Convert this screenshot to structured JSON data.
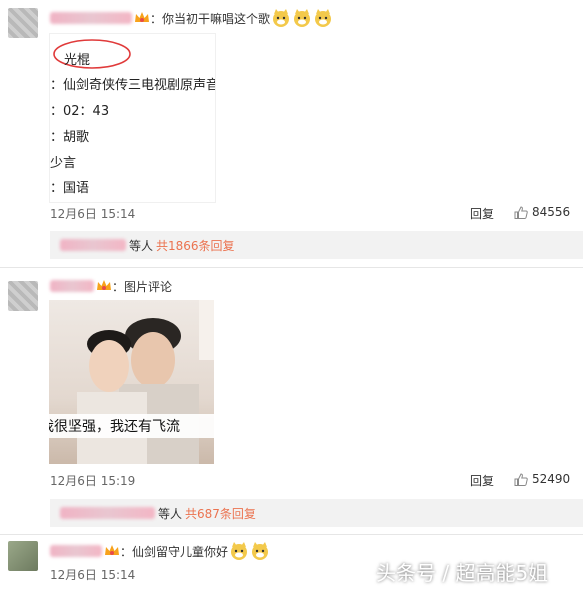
{
  "comments": [
    {
      "text": "：你当初干嘛唱这个歌",
      "song_info": {
        "title": "光棍",
        "album": "：仙剑奇侠传三电视剧原声音",
        "duration": "：02：43",
        "genre": "：胡歌",
        "lyricist": "少言",
        "language": "：国语"
      },
      "date": "12月6日 15:14",
      "reply_label": "回复",
      "likes": "84556",
      "replies": {
        "prefix": "等人",
        "count": "共1866条回复"
      }
    },
    {
      "text": "：图片评论",
      "image_caption": "我很坚强，我还有飞流",
      "date": "12月6日 15:19",
      "reply_label": "回复",
      "likes": "52490",
      "replies": {
        "prefix": "等人",
        "count": "共687条回复"
      }
    },
    {
      "text": "：仙剑留守儿童你好",
      "date": "12月6日 15:14"
    }
  ],
  "watermark": "头条号 / 超高能5姐",
  "colors": {
    "accent_orange": "#eb7350",
    "reply_bg": "#f2f2f2",
    "text": "#333333",
    "meta": "#666666"
  }
}
